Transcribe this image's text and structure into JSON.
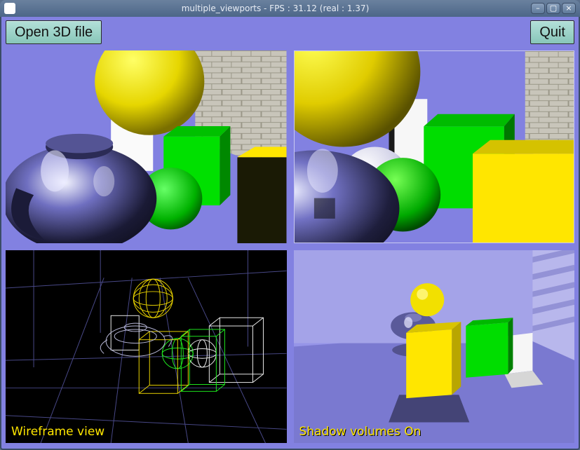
{
  "window": {
    "title": "multiple_viewports - FPS : 31.12 (real : 1.37)"
  },
  "toolbar": {
    "open_label": "Open 3D file",
    "quit_label": "Quit"
  },
  "viewports": {
    "top_left": {
      "caption": ""
    },
    "top_right": {
      "caption": ""
    },
    "bottom_left": {
      "caption": "Wireframe view"
    },
    "bottom_right": {
      "caption": "Shadow volumes On"
    }
  },
  "titlebar_controls": {
    "minimize": "–",
    "maximize": "▢",
    "close": "×"
  }
}
